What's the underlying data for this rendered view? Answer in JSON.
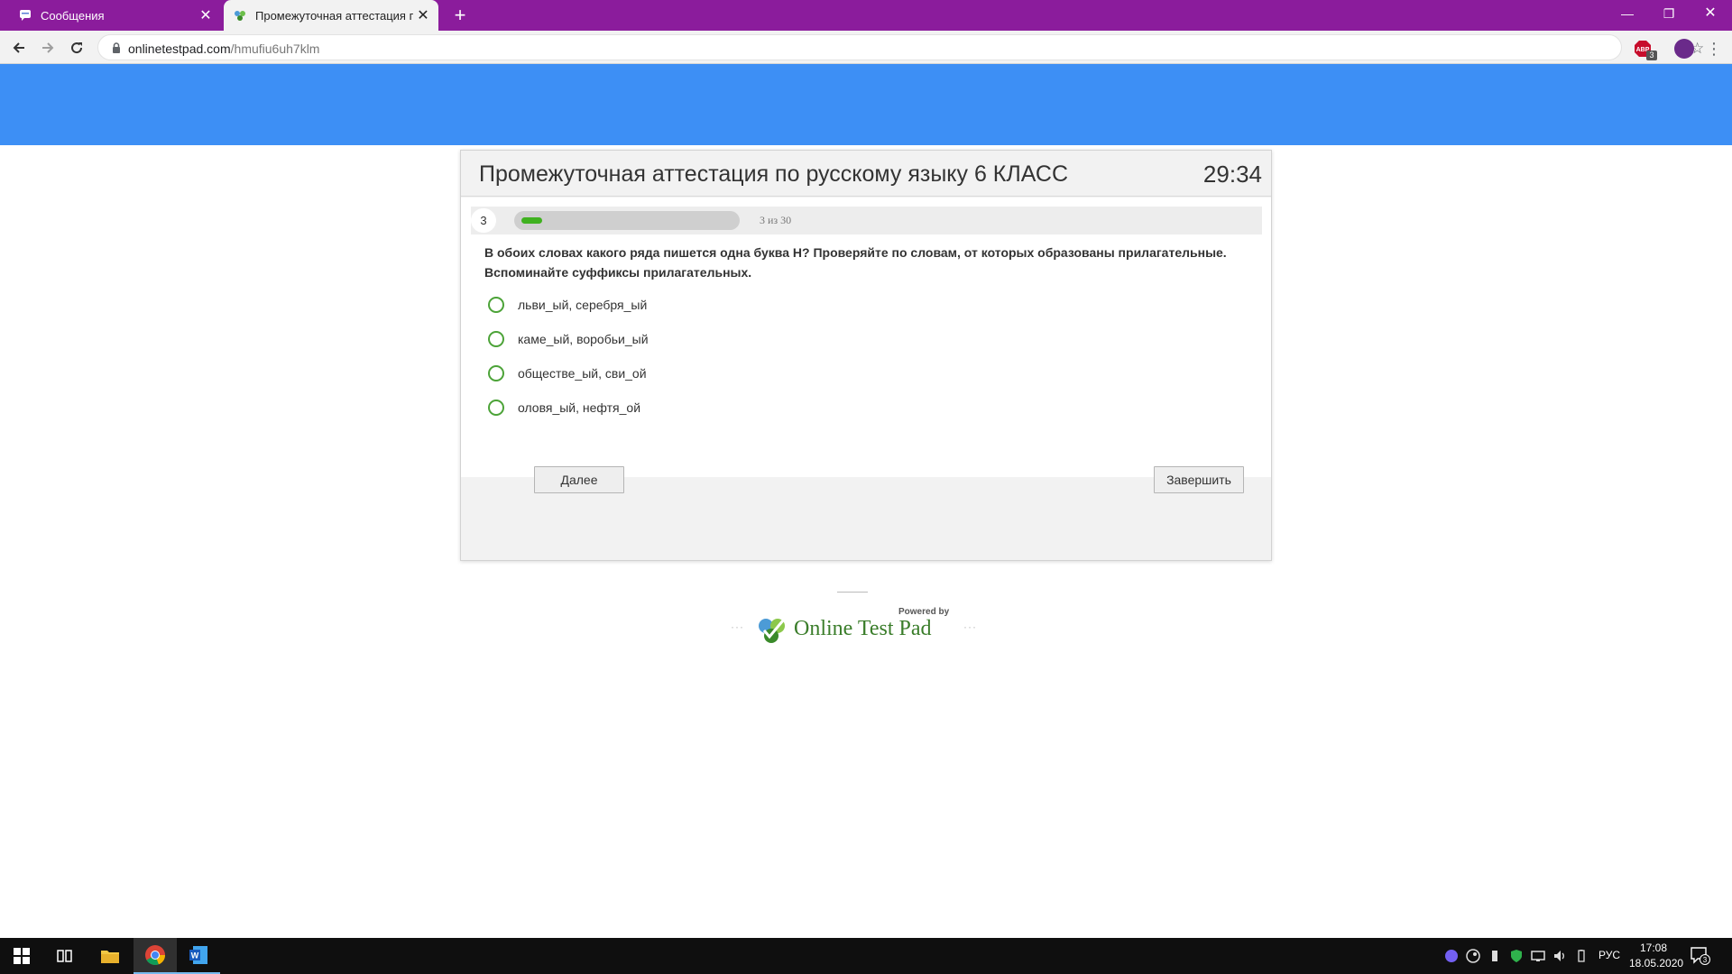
{
  "browser": {
    "tabs": [
      {
        "label": "Сообщения",
        "active": false,
        "icon": "chat-icon"
      },
      {
        "label": "Промежуточная аттестация по русскому языку 6 КЛАСС",
        "active": true,
        "icon": "testpad-icon"
      }
    ],
    "url_host": "onlinetestpad.com",
    "url_path": "/hmufiu6uh7klm",
    "ext_badge": "3"
  },
  "test": {
    "title": "Промежуточная аттестация по русскому языку 6 КЛАСС",
    "timer": "29:34",
    "question_number": "3",
    "progress_text": "3 из 30",
    "progress": {
      "current": 3,
      "total": 30
    },
    "question": "В обоих словах какого ряда пишется одна буква Н? Проверяйте по словам, от которых образованы прилагательные. Вспоминайте суффиксы прилагательных.",
    "options": [
      "льви_ый, серебря_ый",
      "каме_ый, воробьи_ый",
      "обществе_ый, сви_ой",
      "оловя_ый, нефтя_ой"
    ],
    "next_label": "Далее",
    "finish_label": "Завершить"
  },
  "footer": {
    "powered_by": "Powered by",
    "brand": "Online Test Pad"
  },
  "taskbar": {
    "language": "РУС",
    "time": "17:08",
    "date": "18.05.2020",
    "notifications": "3"
  },
  "colors": {
    "titlebar": "#8b1c9c",
    "header_blue": "#3d8ff5",
    "progress_green": "#3fb11f",
    "radio_green": "#4ca338"
  }
}
